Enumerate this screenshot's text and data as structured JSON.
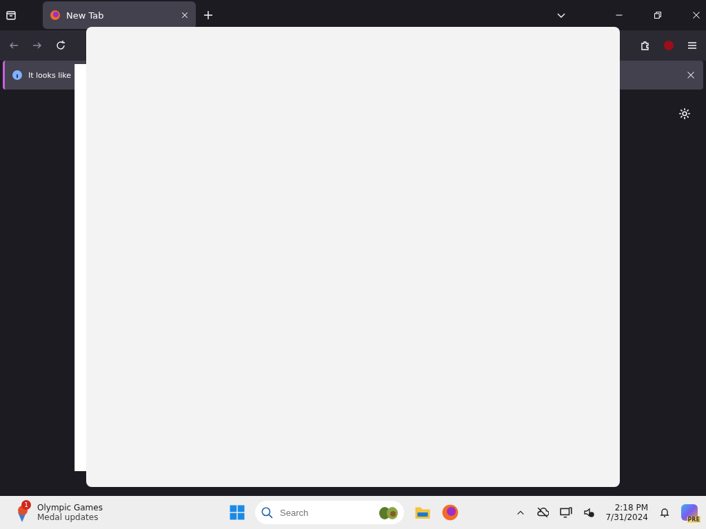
{
  "tabs": [
    {
      "title": "New Tab",
      "selected": true
    }
  ],
  "notification": {
    "text": "It looks like"
  },
  "taskbar": {
    "widget": {
      "badge": "1",
      "title": "Olympic Games",
      "subtitle": "Medal updates"
    },
    "search": {
      "placeholder": "Search"
    },
    "clock": {
      "time": "2:18 PM",
      "date": "7/31/2024"
    },
    "copilot_badge": "PRE"
  }
}
